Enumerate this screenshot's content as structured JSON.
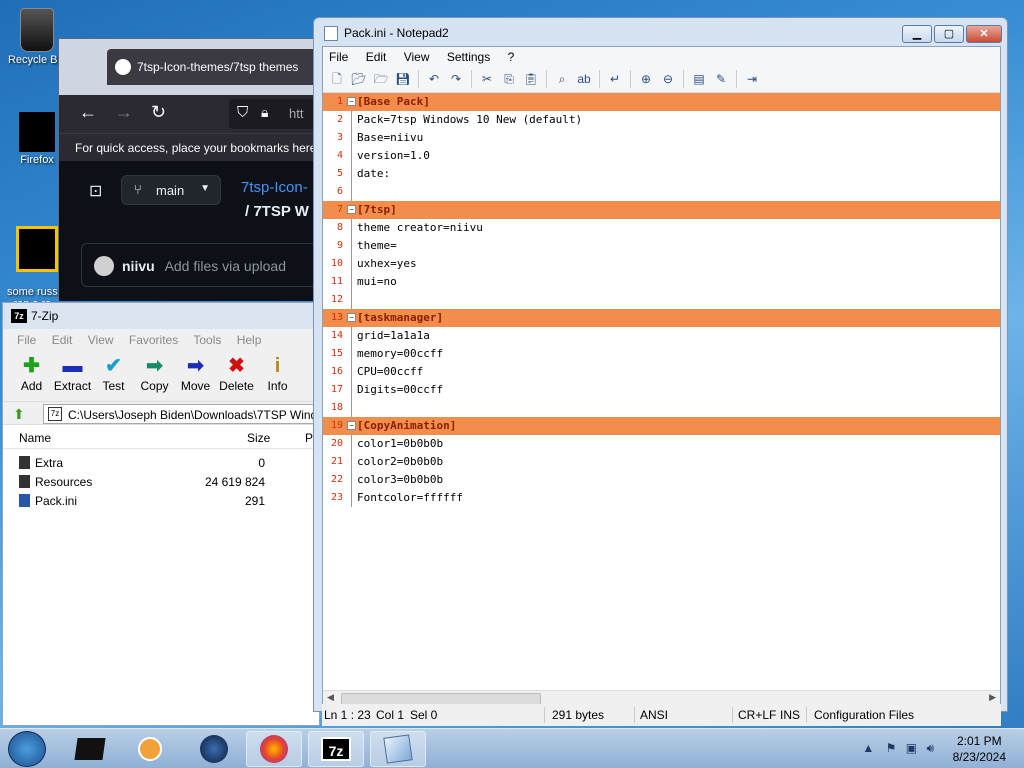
{
  "desktop": {
    "icons": [
      {
        "label": "Recycle Bin"
      },
      {
        "label": "Firefox"
      },
      {
        "label": "some russ...\nran a ra..."
      }
    ]
  },
  "firefox": {
    "tab_title": "7tsp-Icon-themes/7tsp themes",
    "url_partial": "htt",
    "bookmarks_hint": "For quick access, place your bookmarks here",
    "branch": "main",
    "repo_link": "7tsp-Icon-",
    "repo_path": "/ 7TSP W",
    "commit_user": "niivu",
    "commit_msg": "Add files via upload"
  },
  "sevenzip": {
    "title": "7-Zip",
    "menu": [
      "File",
      "Edit",
      "View",
      "Favorites",
      "Tools",
      "Help"
    ],
    "toolbar": [
      {
        "label": "Add",
        "icon": "plus-icon",
        "color": "#1aa31a"
      },
      {
        "label": "Extract",
        "icon": "minus-icon",
        "color": "#1a2fb8"
      },
      {
        "label": "Test",
        "icon": "check-icon",
        "color": "#1a9fc9"
      },
      {
        "label": "Copy",
        "icon": "copy-arrow-icon",
        "color": "#1a8a6a"
      },
      {
        "label": "Move",
        "icon": "move-arrow-icon",
        "color": "#1a2fb8"
      },
      {
        "label": "Delete",
        "icon": "delete-x-icon",
        "color": "#d01010"
      },
      {
        "label": "Info",
        "icon": "info-icon",
        "color": "#b08a10"
      }
    ],
    "path": "C:\\Users\\Joseph Biden\\Downloads\\7TSP Wind",
    "columns": {
      "name": "Name",
      "size": "Size",
      "packed": "P"
    },
    "rows": [
      {
        "name": "Extra",
        "size": "0"
      },
      {
        "name": "Resources",
        "size": "24 619 824"
      },
      {
        "name": "Pack.ini",
        "size": "291"
      }
    ]
  },
  "notepad": {
    "title": "Pack.ini - Notepad2",
    "menu": [
      "File",
      "Edit",
      "View",
      "Settings",
      "?"
    ],
    "lines": [
      {
        "n": "1",
        "text": "[Base Pack]",
        "section": true
      },
      {
        "n": "2",
        "text": "Pack=7tsp Windows 10 New (default)"
      },
      {
        "n": "3",
        "text": "Base=niivu"
      },
      {
        "n": "4",
        "text": "version=1.0"
      },
      {
        "n": "5",
        "text": "date:"
      },
      {
        "n": "6",
        "text": ""
      },
      {
        "n": "7",
        "text": "[7tsp]",
        "section": true
      },
      {
        "n": "8",
        "text": "theme creator=niivu"
      },
      {
        "n": "9",
        "text": "theme="
      },
      {
        "n": "10",
        "text": "uxhex=yes"
      },
      {
        "n": "11",
        "text": "mui=no"
      },
      {
        "n": "12",
        "text": ""
      },
      {
        "n": "13",
        "text": "[taskmanager]",
        "section": true
      },
      {
        "n": "14",
        "text": "grid=1a1a1a"
      },
      {
        "n": "15",
        "text": "memory=00ccff"
      },
      {
        "n": "16",
        "text": "CPU=00ccff"
      },
      {
        "n": "17",
        "text": "Digits=00ccff"
      },
      {
        "n": "18",
        "text": ""
      },
      {
        "n": "19",
        "text": "[CopyAnimation]",
        "section": true
      },
      {
        "n": "20",
        "text": "color1=0b0b0b"
      },
      {
        "n": "21",
        "text": "color2=0b0b0b"
      },
      {
        "n": "22",
        "text": "color3=0b0b0b"
      },
      {
        "n": "23",
        "text": "Fontcolor=ffffff"
      }
    ],
    "status": {
      "pos": "Ln 1 : 23",
      "col": "Col 1",
      "sel": "Sel 0",
      "size": "291 bytes",
      "encoding": "ANSI",
      "eol": "CR+LF",
      "ins": "INS",
      "lexer": "Configuration Files"
    },
    "section_color": "#f28d4b"
  },
  "taskbar": {
    "time": "2:01 PM",
    "date": "8/23/2024"
  }
}
